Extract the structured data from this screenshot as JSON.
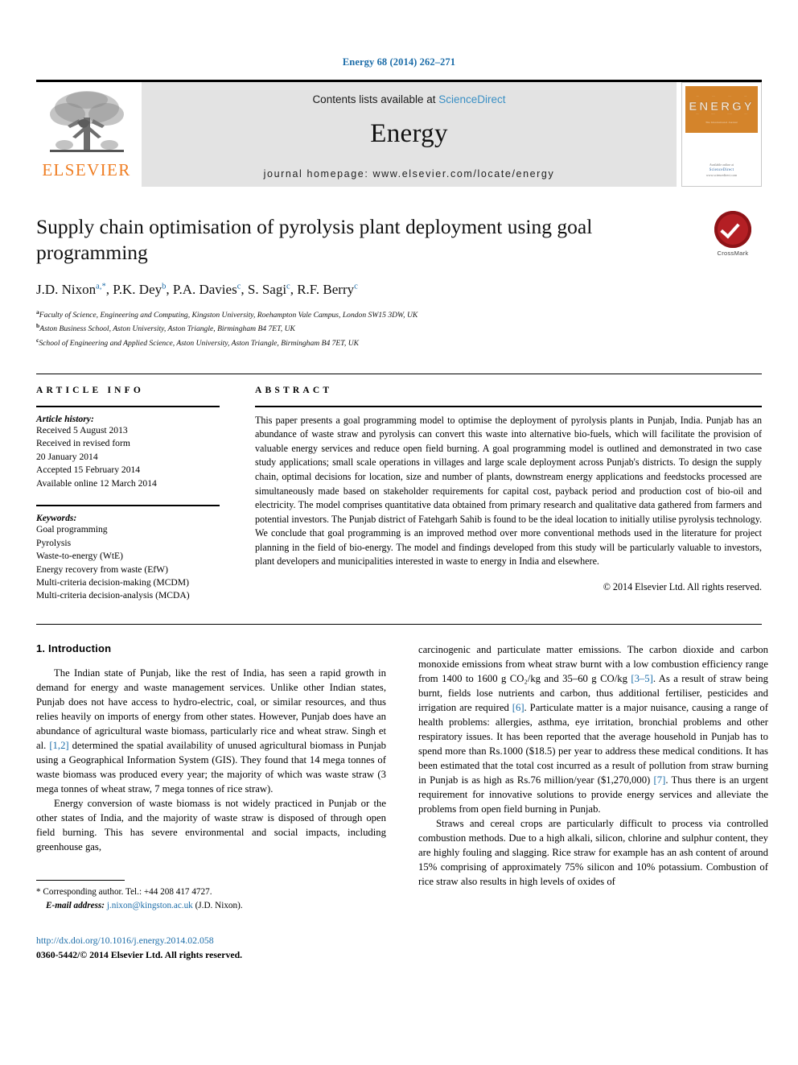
{
  "running_head": "Energy 68 (2014) 262–271",
  "masthead": {
    "publisher_name": "ELSEVIER",
    "contents_prefix": "Contents lists available at ",
    "contents_link": "ScienceDirect",
    "journal_title": "Energy",
    "homepage": "journal homepage: www.elsevier.com/locate/energy",
    "cover": {
      "title": "ENERGY",
      "subtitle": "The International Journal",
      "footer_line1": "Available online at",
      "footer_line2": "ScienceDirect",
      "footer_line3": "www.sciencedirect.com"
    }
  },
  "article": {
    "title": "Supply chain optimisation of pyrolysis plant deployment using goal programming",
    "authors": [
      {
        "name": "J.D. Nixon",
        "marks": "a,*"
      },
      {
        "name": "P.K. Dey",
        "marks": "b"
      },
      {
        "name": "P.A. Davies",
        "marks": "c"
      },
      {
        "name": "S. Sagi",
        "marks": "c"
      },
      {
        "name": "R.F. Berry",
        "marks": "c"
      }
    ],
    "affiliations": [
      {
        "mark": "a",
        "text": "Faculty of Science, Engineering and Computing, Kingston University, Roehampton Vale Campus, London SW15 3DW, UK"
      },
      {
        "mark": "b",
        "text": "Aston Business School, Aston University, Aston Triangle, Birmingham B4 7ET, UK"
      },
      {
        "mark": "c",
        "text": "School of Engineering and Applied Science, Aston University, Aston Triangle, Birmingham B4 7ET, UK"
      }
    ],
    "crossmark_label": "CrossMark"
  },
  "article_info": {
    "heading": "ARTICLE INFO",
    "history_label": "Article history:",
    "history": [
      "Received 5 August 2013",
      "Received in revised form",
      "20 January 2014",
      "Accepted 15 February 2014",
      "Available online 12 March 2014"
    ],
    "keywords_label": "Keywords:",
    "keywords": [
      "Goal programming",
      "Pyrolysis",
      "Waste-to-energy (WtE)",
      "Energy recovery from waste (EfW)",
      "Multi-criteria decision-making (MCDM)",
      "Multi-criteria decision-analysis (MCDA)"
    ]
  },
  "abstract": {
    "heading": "ABSTRACT",
    "text": "This paper presents a goal programming model to optimise the deployment of pyrolysis plants in Punjab, India. Punjab has an abundance of waste straw and pyrolysis can convert this waste into alternative bio-fuels, which will facilitate the provision of valuable energy services and reduce open field burning. A goal programming model is outlined and demonstrated in two case study applications; small scale operations in villages and large scale deployment across Punjab's districts. To design the supply chain, optimal decisions for location, size and number of plants, downstream energy applications and feedstocks processed are simultaneously made based on stakeholder requirements for capital cost, payback period and production cost of bio-oil and electricity. The model comprises quantitative data obtained from primary research and qualitative data gathered from farmers and potential investors. The Punjab district of Fatehgarh Sahib is found to be the ideal location to initially utilise pyrolysis technology. We conclude that goal programming is an improved method over more conventional methods used in the literature for project planning in the field of bio-energy. The model and findings developed from this study will be particularly valuable to investors, plant developers and municipalities interested in waste to energy in India and elsewhere.",
    "copyright": "© 2014 Elsevier Ltd. All rights reserved."
  },
  "body": {
    "section_number_title": "1. Introduction",
    "left_paragraphs": [
      "The Indian state of Punjab, like the rest of India, has seen a rapid growth in demand for energy and waste management services. Unlike other Indian states, Punjab does not have access to hydro-electric, coal, or similar resources, and thus relies heavily on imports of energy from other states. However, Punjab does have an abundance of agricultural waste biomass, particularly rice and wheat straw. Singh et al. [1,2] determined the spatial availability of unused agricultural biomass in Punjab using a Geographical Information System (GIS). They found that 14 mega tonnes of waste biomass was produced every year; the majority of which was waste straw (3 mega tonnes of wheat straw, 7 mega tonnes of rice straw).",
      "Energy conversion of waste biomass is not widely practiced in Punjab or the other states of India, and the majority of waste straw is disposed of through open field burning. This has severe environmental and social impacts, including greenhouse gas,"
    ],
    "right_paragraphs": [
      "carcinogenic and particulate matter emissions. The carbon dioxide and carbon monoxide emissions from wheat straw burnt with a low combustion efficiency range from 1400 to 1600 g CO₂/kg and 35–60 g CO/kg [3–5]. As a result of straw being burnt, fields lose nutrients and carbon, thus additional fertiliser, pesticides and irrigation are required [6]. Particulate matter is a major nuisance, causing a range of health problems: allergies, asthma, eye irritation, bronchial problems and other respiratory issues. It has been reported that the average household in Punjab has to spend more than Rs.1000 ($18.5) per year to address these medical conditions. It has been estimated that the total cost incurred as a result of pollution from straw burning in Punjab is as high as Rs.76 million/year ($1,270,000) [7]. Thus there is an urgent requirement for innovative solutions to provide energy services and alleviate the problems from open field burning in Punjab.",
      "Straws and cereal crops are particularly difficult to process via controlled combustion methods. Due to a high alkali, silicon, chlorine and sulphur content, they are highly fouling and slagging. Rice straw for example has an ash content of around 15% comprising of approximately 75% silicon and 10% potassium. Combustion of rice straw also results in high levels of oxides of"
    ]
  },
  "footer": {
    "corresponding_star": "*",
    "corresponding_text": "Corresponding author. Tel.: +44 208 417 4727.",
    "email_label": "E-mail address:",
    "email": "j.nixon@kingston.ac.uk",
    "email_suffix": "(J.D. Nixon).",
    "doi": "http://dx.doi.org/10.1016/j.energy.2014.02.058",
    "issn_line": "0360-5442/© 2014 Elsevier Ltd. All rights reserved."
  },
  "colors": {
    "link_blue": "#1b6ca8",
    "elsevier_orange": "#ef7d22",
    "crossmark_red": "#b41f24",
    "band_grey": "#e3e3e3"
  }
}
